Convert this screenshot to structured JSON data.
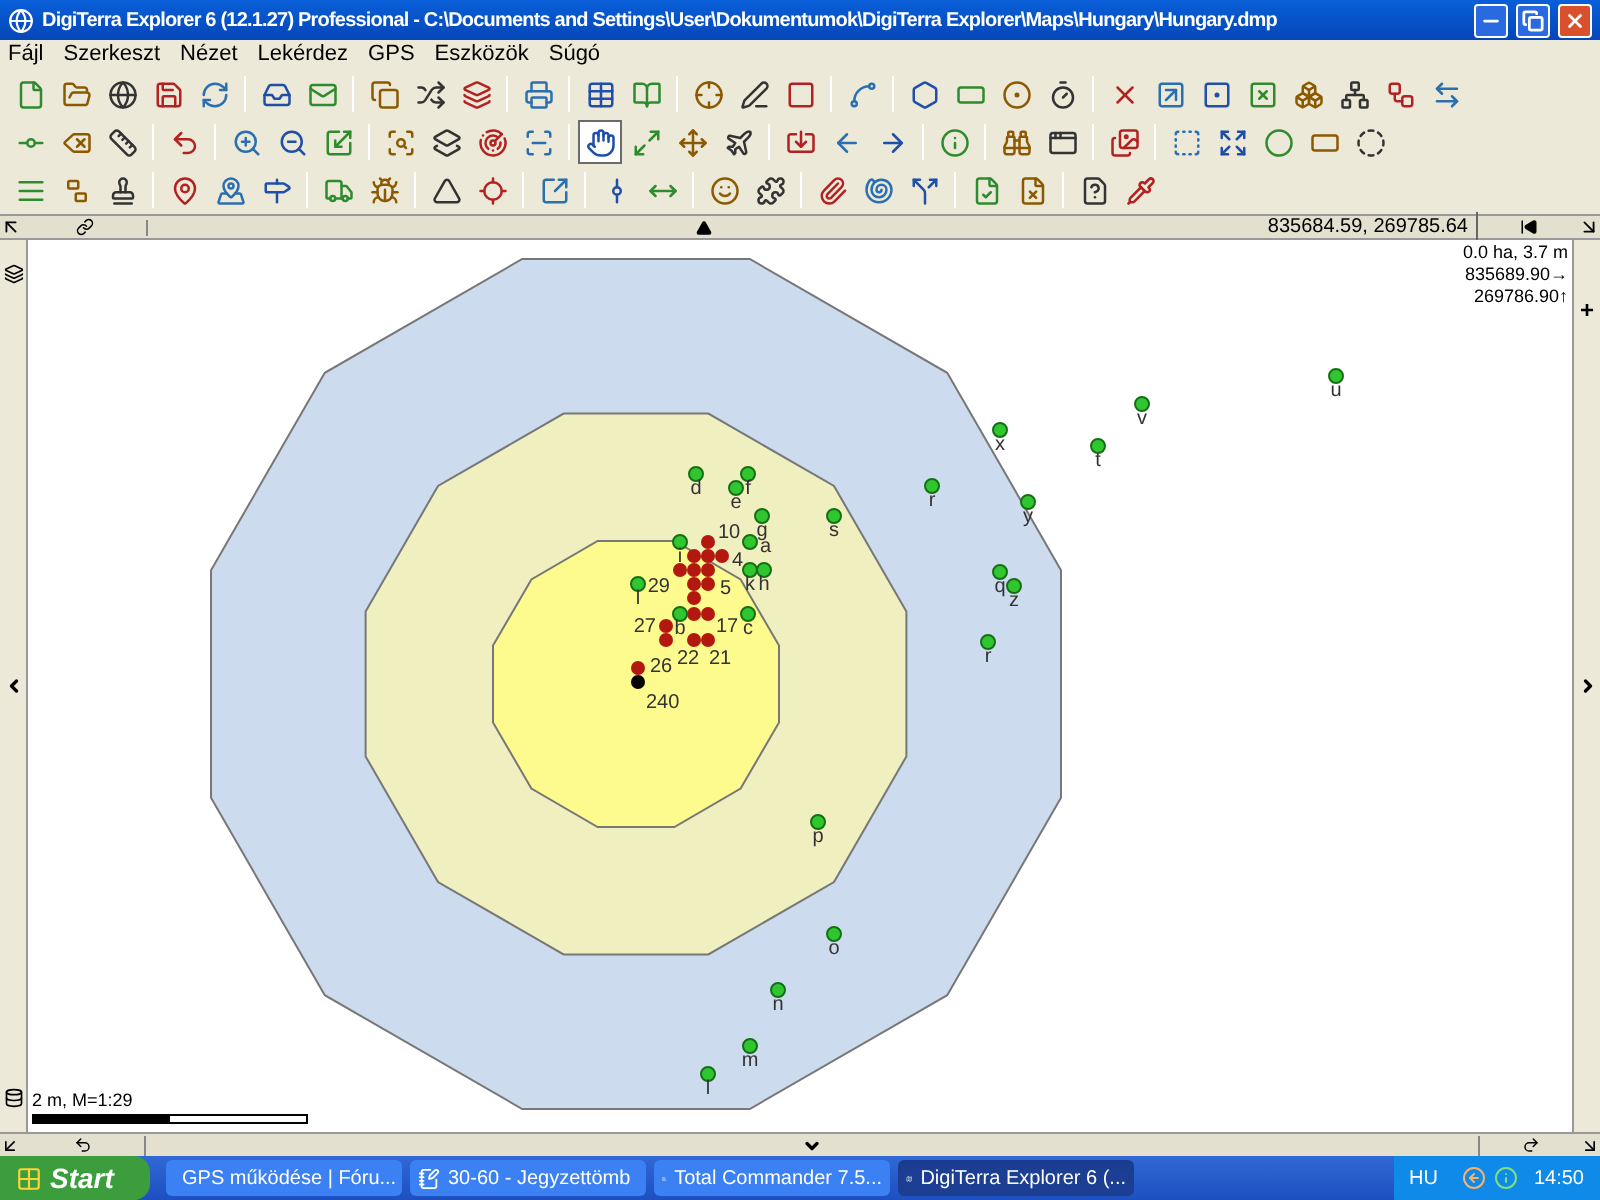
{
  "window": {
    "title": "DigiTerra Explorer 6 (12.1.27) Professional - C:\\Documents and Settings\\User\\Dokumentumok\\DigiTerra Explorer\\Maps\\Hungary\\Hungary.dmp"
  },
  "menu": [
    "Fájl",
    "Szerkeszt",
    "Nézet",
    "Lekérdez",
    "GPS",
    "Eszközök",
    "Súgó"
  ],
  "pan_tool": {
    "selected": true
  },
  "top_bar": {
    "coordinates": "835684.59, 269785.64"
  },
  "map_info": [
    "0.0 ha, 3.7 m",
    "835689.90→",
    "269786.90↑"
  ],
  "map_plus": "+",
  "map": {
    "points": [
      {
        "label": "d",
        "kind": "waypoint"
      },
      {
        "label": "f",
        "kind": "waypoint"
      },
      {
        "label": "e",
        "kind": "waypoint"
      },
      {
        "label": "g",
        "kind": "waypoint"
      },
      {
        "label": "s",
        "kind": "waypoint"
      },
      {
        "label": "r",
        "kind": "waypoint"
      },
      {
        "label": "x",
        "kind": "waypoint"
      },
      {
        "label": "t",
        "kind": "waypoint"
      },
      {
        "label": "v",
        "kind": "waypoint"
      },
      {
        "label": "u",
        "kind": "waypoint"
      },
      {
        "label": "y",
        "kind": "waypoint"
      },
      {
        "label": "q",
        "kind": "waypoint"
      },
      {
        "label": "z",
        "kind": "waypoint"
      },
      {
        "label": "r",
        "kind": "waypoint"
      },
      {
        "label": "i",
        "kind": "waypoint"
      },
      {
        "label": "a",
        "kind": "waypoint"
      },
      {
        "label": "k",
        "kind": "waypoint"
      },
      {
        "label": "h",
        "kind": "waypoint"
      },
      {
        "label": "l",
        "kind": "waypoint"
      },
      {
        "label": "b",
        "kind": "waypoint"
      },
      {
        "label": "c",
        "kind": "waypoint"
      },
      {
        "label": "p",
        "kind": "waypoint"
      },
      {
        "label": "o",
        "kind": "waypoint"
      },
      {
        "label": "n",
        "kind": "waypoint"
      },
      {
        "label": "m",
        "kind": "waypoint"
      },
      {
        "label": "l",
        "kind": "waypoint"
      },
      {
        "label": "10",
        "kind": "trackpoint"
      },
      {
        "label": "4",
        "kind": "trackpoint"
      },
      {
        "label": "29",
        "kind": "trackpoint"
      },
      {
        "label": "5",
        "kind": "trackpoint"
      },
      {
        "label": "27",
        "kind": "trackpoint"
      },
      {
        "label": "17",
        "kind": "trackpoint"
      },
      {
        "label": "22",
        "kind": "trackpoint"
      },
      {
        "label": "21",
        "kind": "trackpoint"
      },
      {
        "label": "26",
        "kind": "trackpoint"
      },
      {
        "label": "240",
        "kind": "current"
      }
    ]
  },
  "scale": "2 m, M=1:29",
  "taskbar": {
    "start": "Start",
    "items": [
      {
        "label": "GPS működése | Fóru...",
        "selected": false
      },
      {
        "label": "30-60 - Jegyzettömb",
        "selected": false
      },
      {
        "label": "Total Commander 7.5...",
        "selected": false
      },
      {
        "label": "DigiTerra Explorer 6 (...",
        "selected": true
      }
    ],
    "language": "HU",
    "clock": "14:50"
  }
}
